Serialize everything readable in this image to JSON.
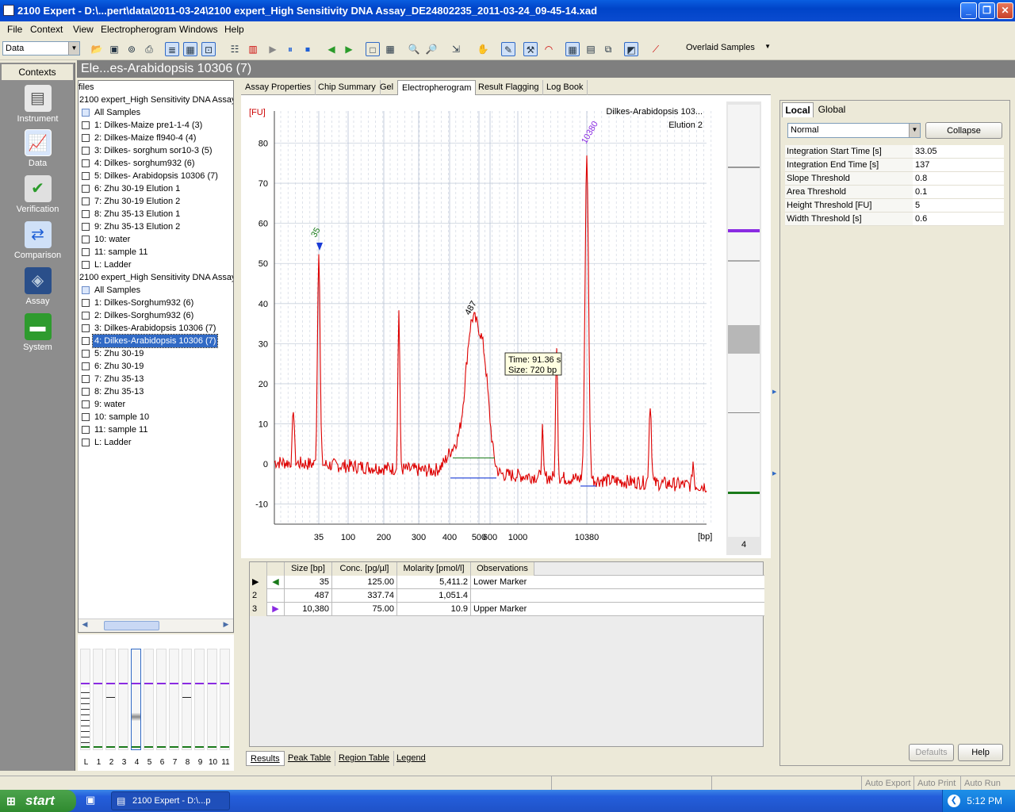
{
  "window": {
    "title": "2100 Expert - D:\\...pert\\data\\2011-03-24\\2100 expert_High Sensitivity DNA Assay_DE24802235_2011-03-24_09-45-14.xad"
  },
  "menu": [
    "File",
    "Context",
    "View",
    "Electropherogram",
    "Windows",
    "Help"
  ],
  "toolbar": {
    "context_select": "Data",
    "view_select": "Overlaid Samples",
    "corner_badge": "4"
  },
  "contexts": {
    "header": "Contexts",
    "items": [
      "Instrument",
      "Data",
      "Verification",
      "Comparison",
      "Assay",
      "System"
    ]
  },
  "sample_header": "Ele...es-Arabidopsis 10306 (7)",
  "tree": {
    "root": "files",
    "groups": [
      {
        "label": "2100 expert_High Sensitivity DNA Assay",
        "all": "All Samples",
        "samples": [
          "1: Dilkes-Maize pre1-1-4 (3)",
          "2: Dilkes-Maize fl940-4 (4)",
          "3: Dilkes- sorghum sor10-3 (5)",
          "4: Dilkes- sorghum932 (6)",
          "5: Dilkes- Arabidopsis 10306 (7)",
          "6: Zhu 30-19 Elution 1",
          "7: Zhu 30-19 Elution 2",
          "8: Zhu 35-13 Elution 1",
          "9: Zhu 35-13 Elution 2",
          "10: water",
          "11: sample 11",
          "L: Ladder"
        ]
      },
      {
        "label": "2100 expert_High Sensitivity DNA Assay",
        "all": "All Samples",
        "samples": [
          "1: Dilkes-Sorghum932 (6)",
          "2: Dilkes-Sorghum932 (6)",
          "3: Dilkes-Arabidopsis 10306 (7)",
          "4: Dilkes-Arabidopsis 10306 (7)",
          "5: Zhu 30-19",
          "6: Zhu 30-19",
          "7: Zhu 35-13",
          "8: Zhu 35-13",
          "9: water",
          "10: sample 10",
          "11: sample 11",
          "L: Ladder"
        ]
      }
    ],
    "selected": "4: Dilkes-Arabidopsis 10306 (7)"
  },
  "gel_thumb_labels": [
    "L",
    "1",
    "2",
    "3",
    "4",
    "5",
    "6",
    "7",
    "8",
    "9",
    "10",
    "11"
  ],
  "view_tabs": [
    "Assay Properties",
    "Chip Summary",
    "Gel",
    "Electropherogram",
    "Result Flagging",
    "Log Book"
  ],
  "active_view_tab": "Electropherogram",
  "chart_data": {
    "type": "line",
    "title": "Dilkes-Arabidopsis 103...",
    "subtitle": "Elution 2",
    "ylabel": "[FU]",
    "xlabel": "[bp]",
    "ylim": [
      -15,
      88
    ],
    "yticks": [
      -10,
      0,
      10,
      20,
      30,
      40,
      50,
      60,
      70,
      80
    ],
    "xtick_labels": [
      "35",
      "100",
      "200",
      "300",
      "400",
      "500",
      "600",
      "1000",
      "10380"
    ],
    "peak_labels": [
      "35",
      "487",
      "10380"
    ],
    "tooltip": {
      "time": "Time: 91.36 s",
      "size": "Size: 720 bp"
    },
    "lane_label": "4",
    "series": [
      {
        "x_bp": [
          35,
          487,
          720,
          10380
        ],
        "y_fu": [
          54,
          35,
          25,
          81
        ]
      }
    ]
  },
  "peak_table": {
    "headers": [
      "Size [bp]",
      "Conc. [pg/µl]",
      "Molarity [pmol/l]",
      "Observations"
    ],
    "rows": [
      {
        "n": "",
        "size": "35",
        "conc": "125.00",
        "mol": "5,411.2",
        "obs": "Lower Marker"
      },
      {
        "n": "2",
        "size": "487",
        "conc": "337.74",
        "mol": "1,051.4",
        "obs": ""
      },
      {
        "n": "3",
        "size": "10,380",
        "conc": "75.00",
        "mol": "10.9",
        "obs": "Upper Marker"
      }
    ]
  },
  "bottom_tabs": [
    "Results",
    "Peak Table",
    "Region Table",
    "Legend"
  ],
  "settings": {
    "tabs": [
      "Local",
      "Global"
    ],
    "mode": "Normal",
    "collapse": "Collapse",
    "props": [
      {
        "k": "Integration Start Time [s]",
        "v": "33.05"
      },
      {
        "k": "Integration End Time [s]",
        "v": "137"
      },
      {
        "k": "Slope Threshold",
        "v": "0.8"
      },
      {
        "k": "Area Threshold",
        "v": "0.1"
      },
      {
        "k": "Height Threshold [FU]",
        "v": "5"
      },
      {
        "k": "Width Threshold [s]",
        "v": "0.6"
      }
    ],
    "defaults": "Defaults",
    "help": "Help"
  },
  "status": [
    "Auto Export",
    "Auto Print",
    "Auto Run"
  ],
  "taskbar": {
    "start": "start",
    "item": "2100 Expert - D:\\...p",
    "clock": "5:12 PM"
  },
  "colors": {
    "trace": "#dd0000",
    "marker_lower": "#1a7a1a",
    "marker_upper": "#8a2be2",
    "selection": "#316ac5"
  }
}
